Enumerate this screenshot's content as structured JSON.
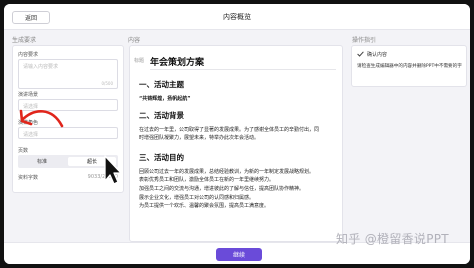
{
  "header": {
    "back_label": "返回",
    "title": "内容概览"
  },
  "columns": {
    "left": "生成要求",
    "center": "内容",
    "right": "操作指引"
  },
  "form": {
    "content_req_label": "内容要求",
    "content_req_placeholder": "请输入内容要求",
    "content_req_count": "0/500",
    "scene_label": "演讲场景",
    "scene_placeholder": "请选择",
    "role_label": "演讲角色",
    "role_placeholder": "请选择",
    "pages_label": "页数",
    "pages_options": [
      "标准",
      "超长"
    ],
    "pages_selected": "超长",
    "word_count_label": "资料字数",
    "word_count_value": "9033/25000"
  },
  "document": {
    "tag": "标题",
    "title": "年会策划方案",
    "sections": [
      {
        "heading": "一、活动主题",
        "lines": [
          "“共铸辉煌，扬帆起航”"
        ]
      },
      {
        "heading": "二、活动背景",
        "lines": [
          "在过去的一年里，公司取得了显著的发展成果。为了感谢全体员工的辛勤付出，同",
          "时增强团队凝聚力，展望未来，特举办此次年会活动。"
        ]
      },
      {
        "heading": "三、活动目的",
        "lines": [
          "回顾公司过去一年的发展成果，总结经验教训，为新的一年制定发展战略规划。",
          "表彰优秀员工和团队，激励全体员工在新的一年里继续努力。",
          "加强员工之间的交流与沟通，增进彼此的了解与信任，提高团队协作精神。",
          "展示企业文化，增强员工对公司的认同感和归属感。",
          "为员工提供一个欢乐、温馨的聚会氛围，提高员工满意度。"
        ]
      }
    ]
  },
  "guide": {
    "heading": "确认内容",
    "text": "请检查生成编辑器中的内容并删除PPT中不需要的字"
  },
  "footer": {
    "continue_label": "继续"
  },
  "watermark": "知乎 @橙留香说PPT",
  "colors": {
    "accent": "#6a4bd9",
    "annotation": "#e0251b",
    "background": "#f3f3f7"
  },
  "icons": [
    "check-icon",
    "arrow-annotation",
    "mouse-cursor-icon"
  ]
}
